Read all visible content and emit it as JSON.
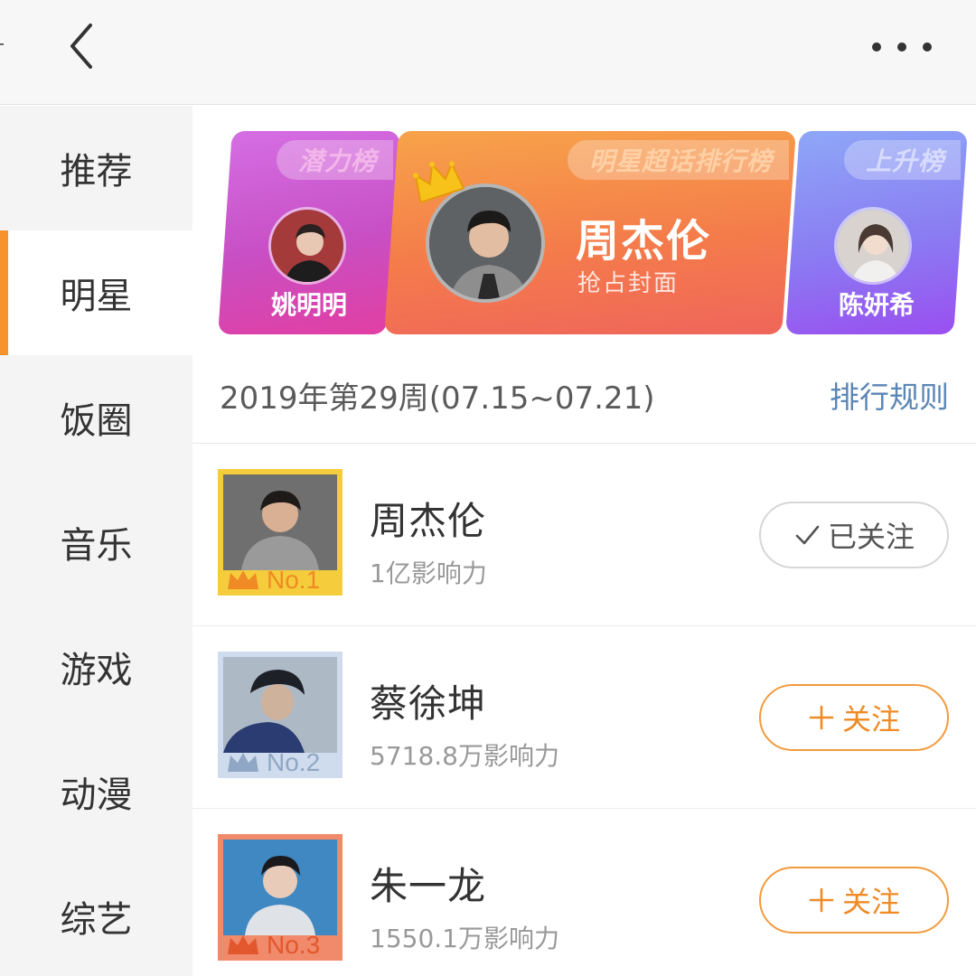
{
  "nav": {
    "back_icon": "chevron-left-icon",
    "more_icon": "more-dots-icon"
  },
  "sidebar": {
    "active_index": 1,
    "accent_color": "#f7932d",
    "items": [
      {
        "label": "推荐"
      },
      {
        "label": "明星"
      },
      {
        "label": "饭圈"
      },
      {
        "label": "音乐"
      },
      {
        "label": "游戏"
      },
      {
        "label": "动漫"
      },
      {
        "label": "综艺"
      }
    ]
  },
  "banner": {
    "left": {
      "tag": "潜力榜",
      "name": "姚明明"
    },
    "center": {
      "tag": "明星超话排行榜",
      "name": "周杰伦",
      "subtitle": "抢占封面"
    },
    "right": {
      "tag": "上升榜",
      "name": "陈妍希"
    }
  },
  "week": {
    "label": "2019年第29周(07.15~07.21)",
    "rules_link": "排行规则"
  },
  "ranking": [
    {
      "rank_label": "No.1",
      "name": "周杰伦",
      "influence": "1亿影响力",
      "button": "已关注",
      "followed": true,
      "frame_color": "#f5cd3c",
      "crown_color": "#f08a24"
    },
    {
      "rank_label": "No.2",
      "name": "蔡徐坤",
      "influence": "5718.8万影响力",
      "button": "关注",
      "followed": false,
      "frame_color": "#cfdcee",
      "crown_color": "#8fa7c4"
    },
    {
      "rank_label": "No.3",
      "name": "朱一龙",
      "influence": "1550.1万影响力",
      "button": "关注",
      "followed": false,
      "frame_color": "#f08a6a",
      "crown_color": "#e2572d"
    }
  ]
}
